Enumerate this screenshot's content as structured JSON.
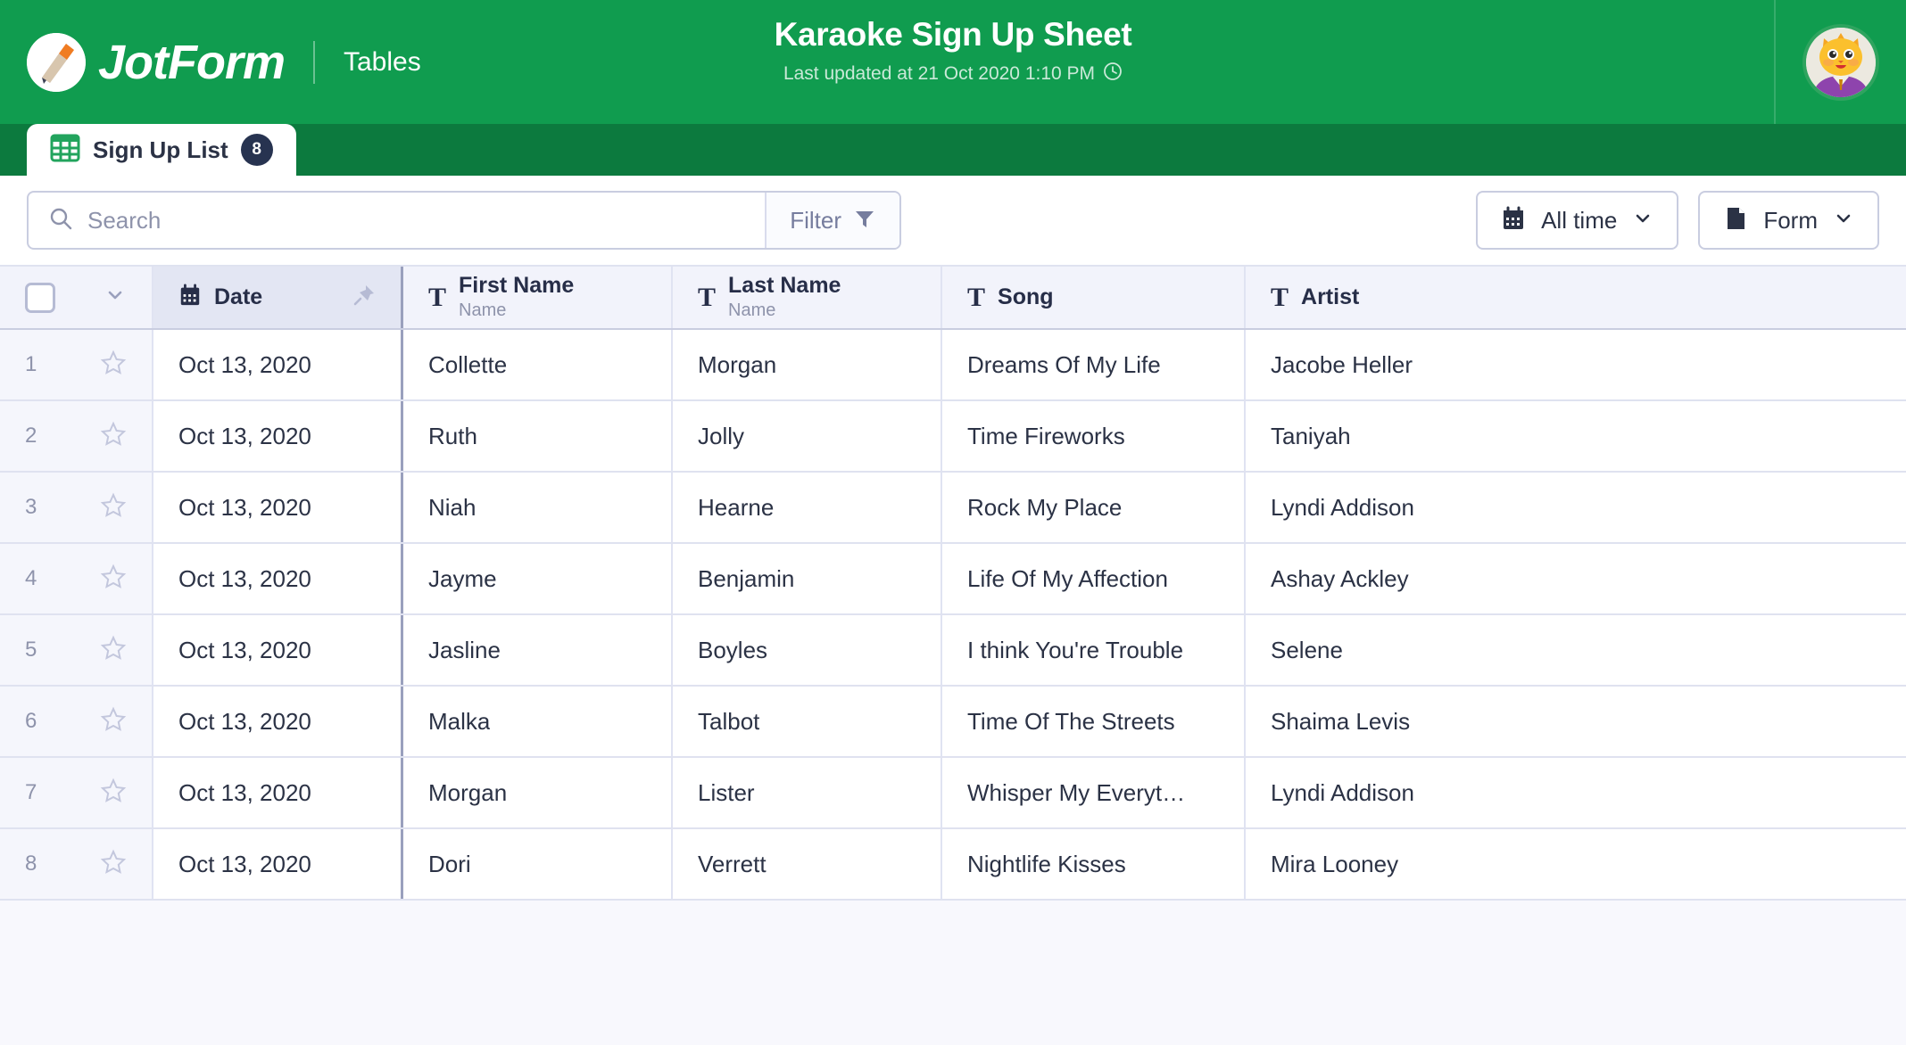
{
  "brand": {
    "name": "JotForm",
    "product": "Tables",
    "logo_icon": "jotform-pencil-logo",
    "green": "#109c4f",
    "dark_green": "#0c7a3e"
  },
  "header": {
    "title": "Karaoke Sign Up Sheet",
    "subtitle": "Last updated at 21 Oct 2020 1:10 PM",
    "clock_icon": "clock-icon",
    "avatar_icon": "cat-avatar"
  },
  "tab": {
    "label": "Sign Up List",
    "count": "8",
    "icon": "grid-table-icon"
  },
  "toolbar": {
    "search_placeholder": "Search",
    "search_value": "",
    "search_icon": "search-icon",
    "filter_label": "Filter",
    "filter_icon": "funnel-icon",
    "date_range_label": "All time",
    "date_range_icon": "calendar-icon",
    "form_label": "Form",
    "form_icon": "document-icon",
    "chevron_icon": "chevron-down-icon"
  },
  "table": {
    "columns": [
      {
        "label": "Date",
        "sub": "",
        "icon": "calendar-icon",
        "pinned": true
      },
      {
        "label": "First Name",
        "sub": "Name",
        "icon": "text-type-icon",
        "pinned": false
      },
      {
        "label": "Last Name",
        "sub": "Name",
        "icon": "text-type-icon",
        "pinned": false
      },
      {
        "label": "Song",
        "sub": "",
        "icon": "text-type-icon",
        "pinned": false
      },
      {
        "label": "Artist",
        "sub": "",
        "icon": "text-type-icon",
        "pinned": false
      }
    ],
    "rows": [
      {
        "n": "1",
        "date": "Oct 13, 2020",
        "first": "Collette",
        "last": "Morgan",
        "song": "Dreams Of My Life",
        "artist": "Jacobe Heller"
      },
      {
        "n": "2",
        "date": "Oct 13, 2020",
        "first": "Ruth",
        "last": "Jolly",
        "song": "Time Fireworks",
        "artist": "Taniyah"
      },
      {
        "n": "3",
        "date": "Oct 13, 2020",
        "first": "Niah",
        "last": "Hearne",
        "song": "Rock My Place",
        "artist": "Lyndi Addison"
      },
      {
        "n": "4",
        "date": "Oct 13, 2020",
        "first": "Jayme",
        "last": "Benjamin",
        "song": "Life Of My Affection",
        "artist": "Ashay Ackley"
      },
      {
        "n": "5",
        "date": "Oct 13, 2020",
        "first": "Jasline",
        "last": "Boyles",
        "song": "I think You're Trouble",
        "artist": "Selene"
      },
      {
        "n": "6",
        "date": "Oct 13, 2020",
        "first": "Malka",
        "last": "Talbot",
        "song": "Time Of The Streets",
        "artist": "Shaima Levis"
      },
      {
        "n": "7",
        "date": "Oct 13, 2020",
        "first": "Morgan",
        "last": "Lister",
        "song": "Whisper My Everyt…",
        "artist": "Lyndi Addison"
      },
      {
        "n": "8",
        "date": "Oct 13, 2020",
        "first": "Dori",
        "last": "Verrett",
        "song": "Nightlife Kisses",
        "artist": "Mira Looney"
      }
    ]
  }
}
